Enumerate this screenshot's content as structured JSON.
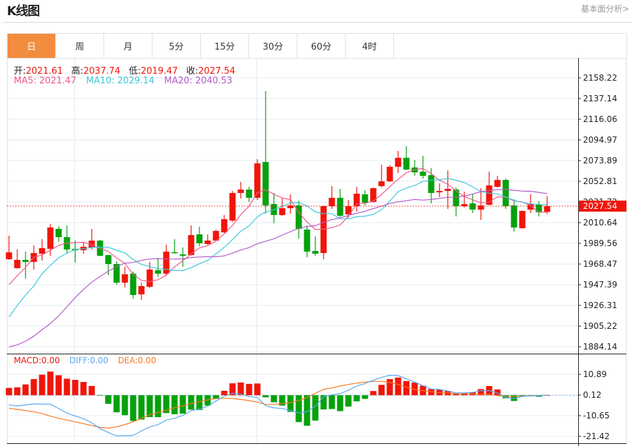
{
  "header": {
    "title": "K线图",
    "fundamental_link": "基本面分析>"
  },
  "tabs": [
    {
      "label": "日",
      "active": true
    },
    {
      "label": "周",
      "active": false
    },
    {
      "label": "月",
      "active": false
    },
    {
      "label": "5分",
      "active": false
    },
    {
      "label": "15分",
      "active": false
    },
    {
      "label": "30分",
      "active": false
    },
    {
      "label": "60分",
      "active": false
    },
    {
      "label": "4时",
      "active": false
    }
  ],
  "info": {
    "open_label": "开:",
    "open": "2021.61",
    "high_label": "高:",
    "high": "2037.74",
    "low_label": "低:",
    "low": "2019.47",
    "close_label": "收:",
    "close": "2027.54",
    "ma5": "MA5: 2021.47",
    "ma10": "MA10: 2029.14",
    "ma20": "MA20: 2040.53"
  },
  "macd_info": {
    "macd": "MACD:0.00",
    "diff": "DIFF:0.00",
    "dea": "DEA:0.00"
  },
  "colors": {
    "up": "#f0150a",
    "down": "#06a10c",
    "ma5": "#f05a8c",
    "ma10": "#3ec8dc",
    "ma20": "#b45cc8",
    "diff": "#5aa8f0",
    "dea": "#f57a22",
    "active_tab": "#f28d3f"
  },
  "chart_data": [
    {
      "type": "candlestick",
      "price_axis_ticks": [
        "2158.22",
        "2137.14",
        "2116.06",
        "2094.97",
        "2073.89",
        "2052.81",
        "2031.72",
        "2010.64",
        "1989.56",
        "1968.47",
        "1947.39",
        "1926.31",
        "1905.22",
        "1884.14"
      ],
      "last_price_label": "2027.54",
      "last_price": 2027.54,
      "ohlc": [
        [
          1973.4,
          1997.3,
          1972.7,
          1980.4
        ],
        [
          1964.3,
          1983.3,
          1963.6,
          1972.7
        ],
        [
          1972.7,
          1981.1,
          1953.7,
          1970.6
        ],
        [
          1970.6,
          1987.5,
          1962.9,
          1979.7
        ],
        [
          1979.0,
          1993.8,
          1972.0,
          1984.7
        ],
        [
          1984.0,
          2009.3,
          1976.9,
          2005.7
        ],
        [
          2004.3,
          2007.1,
          1991.0,
          1995.9
        ],
        [
          1995.9,
          2007.8,
          1979.0,
          1983.3
        ],
        [
          1984.0,
          1992.4,
          1969.9,
          1982.6
        ],
        [
          1982.6,
          1990.3,
          1979.0,
          1986.1
        ],
        [
          1985.4,
          2004.3,
          1983.3,
          1992.4
        ],
        [
          1992.4,
          1993.1,
          1976.5,
          1976.9
        ],
        [
          1977.6,
          1978.0,
          1957.3,
          1968.5
        ],
        [
          1968.5,
          1971.3,
          1947.4,
          1949.5
        ],
        [
          1949.5,
          1965.7,
          1944.6,
          1958.0
        ],
        [
          1958.7,
          1960.8,
          1933.4,
          1936.9
        ],
        [
          1937.6,
          1949.5,
          1932.0,
          1946.0
        ],
        [
          1945.3,
          1970.6,
          1943.9,
          1962.9
        ],
        [
          1962.2,
          1974.8,
          1955.1,
          1958.7
        ],
        [
          1958.7,
          1988.2,
          1956.5,
          1981.1
        ],
        [
          1980.6,
          1993.8,
          1979.0,
          1979.5
        ],
        [
          1978.3,
          1985.4,
          1965.7,
          1976.9
        ],
        [
          1977.6,
          2007.8,
          1976.9,
          1998.0
        ],
        [
          1998.7,
          2006.4,
          1986.8,
          1989.6
        ],
        [
          1988.9,
          1998.7,
          1988.2,
          1992.4
        ],
        [
          1992.4,
          2003.6,
          1991.7,
          2002.2
        ],
        [
          2000.8,
          2018.4,
          2000.1,
          2014.2
        ],
        [
          2012.8,
          2043.0,
          2011.4,
          2040.9
        ],
        [
          2040.9,
          2052.1,
          2035.3,
          2044.4
        ],
        [
          2044.4,
          2047.2,
          2031.7,
          2036.0
        ],
        [
          2036.0,
          2075.3,
          2033.8,
          2071.1
        ],
        [
          2072.5,
          2144.9,
          2019.8,
          2028.2
        ],
        [
          2029.6,
          2040.9,
          2010.0,
          2018.4
        ],
        [
          2018.4,
          2036.0,
          2017.7,
          2025.4
        ],
        [
          2025.4,
          2039.5,
          2019.8,
          2028.2
        ],
        [
          2028.2,
          2033.1,
          1994.5,
          2004.3
        ],
        [
          2003.6,
          2007.8,
          1975.5,
          1981.1
        ],
        [
          1981.8,
          1996.6,
          1976.9,
          1979.0
        ],
        [
          1979.7,
          2027.9,
          1973.4,
          2027.5
        ],
        [
          2027.5,
          2047.9,
          2024.7,
          2036.0
        ],
        [
          2036.0,
          2045.1,
          2016.5,
          2017.7
        ],
        [
          2019.1,
          2033.8,
          2015.6,
          2027.5
        ],
        [
          2027.5,
          2047.2,
          2021.9,
          2040.2
        ],
        [
          2039.5,
          2043.7,
          2028.2,
          2031.0
        ],
        [
          2031.7,
          2046.5,
          2031.0,
          2045.8
        ],
        [
          2047.9,
          2069.7,
          2046.5,
          2052.8
        ],
        [
          2052.8,
          2069.0,
          2052.1,
          2067.6
        ],
        [
          2067.6,
          2083.8,
          2061.3,
          2076.8
        ],
        [
          2076.8,
          2088.6,
          2064.1,
          2064.8
        ],
        [
          2066.9,
          2074.6,
          2058.4,
          2061.9
        ],
        [
          2062.6,
          2078.8,
          2055.6,
          2058.4
        ],
        [
          2059.1,
          2066.2,
          2030.3,
          2040.9
        ],
        [
          2041.6,
          2050.7,
          2036.7,
          2043.0
        ],
        [
          2043.0,
          2064.0,
          2024.7,
          2045.1
        ],
        [
          2044.4,
          2046.5,
          2017.0,
          2027.5
        ],
        [
          2027.5,
          2042.3,
          2026.1,
          2029.6
        ],
        [
          2030.3,
          2039.5,
          2020.5,
          2024.0
        ],
        [
          2024.0,
          2045.8,
          2013.5,
          2028.2
        ],
        [
          2028.9,
          2062.6,
          2028.2,
          2048.6
        ],
        [
          2047.2,
          2058.4,
          2046.5,
          2054.2
        ],
        [
          2054.2,
          2055.6,
          2024.7,
          2027.5
        ],
        [
          2028.2,
          2034.5,
          2001.5,
          2005.7
        ],
        [
          2005.0,
          2023.0,
          2004.6,
          2022.6
        ],
        [
          2024.0,
          2039.5,
          2020.5,
          2029.6
        ],
        [
          2028.9,
          2032.4,
          2017.0,
          2021.2
        ],
        [
          2021.61,
          2037.74,
          2019.47,
          2027.54
        ]
      ],
      "ma5_leading": [
        1947.4,
        1956.5,
        1965.0,
        1975.5
      ],
      "ma10_leading": [
        1914.4,
        1926.3,
        1936.9,
        1946.0,
        1958.7,
        1967.1,
        1974.8,
        1979.7,
        1983.3
      ],
      "ma20_leading": [
        1883.9,
        1886.1,
        1889.8,
        1894.9,
        1901.5,
        1907.8,
        1915.6,
        1924.9,
        1934.3,
        1942.5,
        1950.0,
        1955.8,
        1961.2,
        1965.9,
        1969.4,
        1970.1,
        1972.2,
        1973.6,
        1973.9
      ]
    },
    {
      "type": "bar+line",
      "axis_ticks": [
        "10.89",
        "0.12",
        "-10.65",
        "-21.42"
      ],
      "macd": [
        3.8,
        4.1,
        5.6,
        8.4,
        10.7,
        12.3,
        10.4,
        8.6,
        8.0,
        6.9,
        4.8,
        -0.2,
        -4.5,
        -8.9,
        -10.4,
        -13.4,
        -12.7,
        -11.4,
        -11.4,
        -9.3,
        -9.9,
        -9.6,
        -7.5,
        -7.7,
        -5.4,
        -1.8,
        2.3,
        6.2,
        6.6,
        5.9,
        6.1,
        -1.1,
        -3.7,
        -5.4,
        -8.7,
        -14.0,
        -15.9,
        -13.2,
        -7.4,
        -7.2,
        -8.3,
        -5.9,
        -3.2,
        -1.9,
        2.2,
        5.4,
        8.4,
        9.2,
        7.4,
        6.6,
        5.0,
        3.2,
        3.0,
        2.2,
        0.8,
        1.2,
        1.6,
        3.2,
        4.8,
        3.0,
        -1.6,
        -3.0,
        -0.7,
        -0.2,
        -0.8,
        0
      ],
      "diff": [
        -5.0,
        -5.6,
        -5.1,
        -4.5,
        -4.6,
        -4.7,
        -6.9,
        -9.3,
        -10.8,
        -12.2,
        -14.4,
        -17.4,
        -19.4,
        -21.2,
        -21.1,
        -20.9,
        -18.6,
        -16.5,
        -15.3,
        -12.9,
        -12.0,
        -10.5,
        -8.0,
        -7.2,
        -5.7,
        -3.0,
        -0.6,
        1.0,
        0.5,
        -0.7,
        -1.2,
        -5.4,
        -6.6,
        -6.9,
        -8.0,
        -9.3,
        -8.6,
        -5.7,
        -0.8,
        0.2,
        0.8,
        2.6,
        4.8,
        6.0,
        7.8,
        9.3,
        10.4,
        10.2,
        8.6,
        6.8,
        5.0,
        3.2,
        3.0,
        2.2,
        1.2,
        1.2,
        1.4,
        2.4,
        2.4,
        1.2,
        -1.2,
        -1.8,
        -0.6,
        -0.4,
        -0.2,
        0
      ],
      "dea": [
        -6.8,
        -7.4,
        -8.0,
        -8.6,
        -9.6,
        -10.9,
        -12.0,
        -12.9,
        -13.9,
        -14.8,
        -15.8,
        -16.8,
        -17.1,
        -16.5,
        -15.3,
        -13.8,
        -12.0,
        -10.2,
        -9.0,
        -7.8,
        -6.5,
        -5.5,
        -4.3,
        -3.4,
        -2.4,
        -1.8,
        -1.6,
        -1.7,
        -2.2,
        -2.8,
        -3.6,
        -4.8,
        -4.8,
        -4.4,
        -3.8,
        -2.8,
        -1.2,
        1.0,
        3.0,
        3.8,
        4.8,
        5.6,
        6.3,
        6.8,
        7.2,
        7.2,
        6.6,
        5.6,
        4.2,
        3.0,
        2.4,
        1.8,
        1.4,
        1.2,
        0.8,
        0.7,
        0.6,
        0.6,
        0.4,
        -0.2,
        -0.6,
        -0.7,
        -0.5,
        -0.2,
        -0.1,
        0
      ]
    }
  ]
}
